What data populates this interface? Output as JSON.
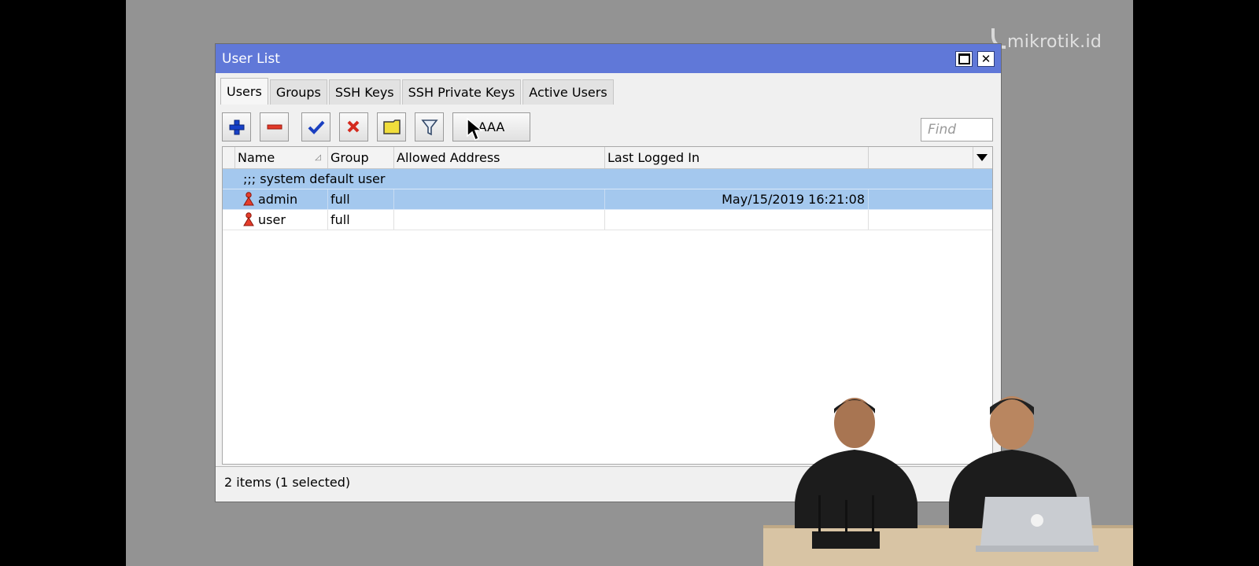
{
  "watermark": {
    "text": "mikrotik.id"
  },
  "window": {
    "title": "User List",
    "maximize_icon": "maximize-icon",
    "close_icon": "close-icon",
    "close_glyph": "✕"
  },
  "tabs": [
    {
      "label": "Users",
      "active": true
    },
    {
      "label": "Groups",
      "active": false
    },
    {
      "label": "SSH Keys",
      "active": false
    },
    {
      "label": "SSH Private Keys",
      "active": false
    },
    {
      "label": "Active Users",
      "active": false
    }
  ],
  "toolbar": {
    "add_icon": "plus-icon",
    "remove_icon": "minus-icon",
    "enable_icon": "checkmark-icon",
    "disable_icon": "x-icon",
    "comment_icon": "note-icon",
    "filter_icon": "filter-icon",
    "aaa_label": "AAA",
    "find_placeholder": "Find",
    "find_value": ""
  },
  "table": {
    "columns": [
      "Name",
      "Group",
      "Allowed Address",
      "Last Logged In"
    ],
    "sort_column": "Name",
    "comment": ";;; system default user",
    "rows": [
      {
        "name": "admin",
        "group": "full",
        "allowed_address": "",
        "last_logged_in": "May/15/2019 16:21:08",
        "selected": true,
        "icon": "user-icon"
      },
      {
        "name": "user",
        "group": "full",
        "allowed_address": "",
        "last_logged_in": "",
        "selected": false,
        "icon": "user-icon"
      }
    ]
  },
  "status": {
    "text": "2 items (1 selected)"
  },
  "colors": {
    "titlebar": "#6078d8",
    "selection": "#a4c8ee",
    "stage_background": "#939393"
  }
}
